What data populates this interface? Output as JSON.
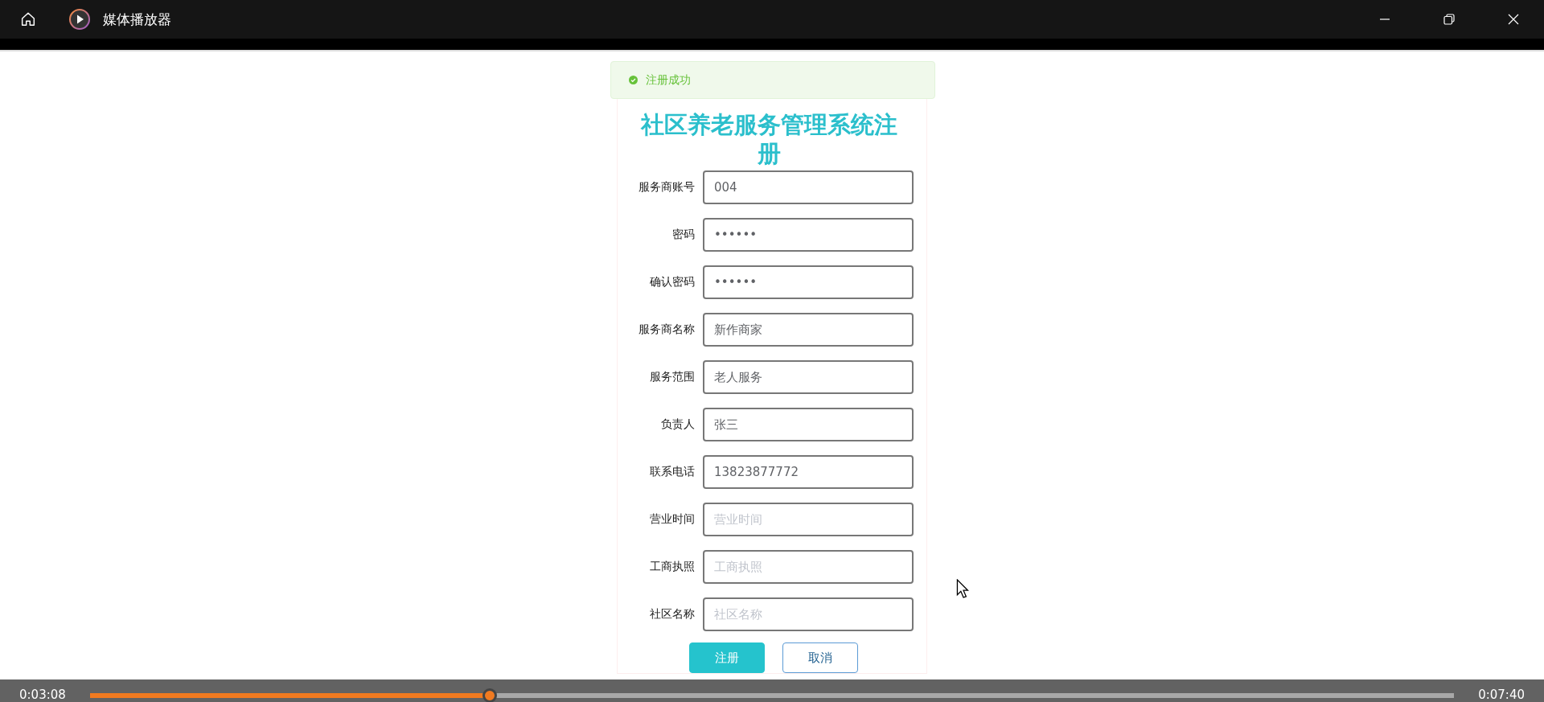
{
  "window": {
    "title": "媒体播放器"
  },
  "toast": {
    "message": "注册成功",
    "kind": "success"
  },
  "form": {
    "title": "社区养老服务管理系统注册",
    "fields": [
      {
        "label": "服务商账号",
        "value": "004"
      },
      {
        "label": "密码",
        "value": "••••••"
      },
      {
        "label": "确认密码",
        "value": "••••••"
      },
      {
        "label": "服务商名称",
        "value": "新作商家"
      },
      {
        "label": "服务范围",
        "value": "老人服务"
      },
      {
        "label": "负责人",
        "value": "张三"
      },
      {
        "label": "联系电话",
        "value": "13823877772"
      },
      {
        "label": "营业时间",
        "placeholder": "营业时间"
      },
      {
        "label": "工商执照",
        "placeholder": "工商执照"
      },
      {
        "label": "社区名称",
        "placeholder": "社区名称"
      }
    ],
    "buttons": [
      {
        "label": "注册",
        "kind": "primary"
      },
      {
        "label": "取消",
        "kind": "plain"
      }
    ]
  },
  "player": {
    "elapsed": "0:03:08",
    "duration": "0:07:40",
    "progress": {
      "level": 0.293
    }
  }
}
